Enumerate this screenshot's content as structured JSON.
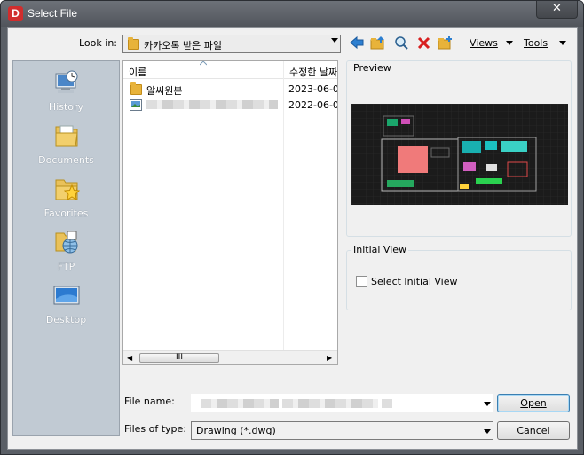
{
  "window": {
    "title": "Select File",
    "app_icon_letter": "D",
    "close_glyph": "✕"
  },
  "toolbar": {
    "look_in_label": "Look in:",
    "look_in_value": "카카오톡 받은 파일",
    "views_label": "Views",
    "tools_label": "Tools"
  },
  "places": [
    {
      "label": "History",
      "icon": "history-icon"
    },
    {
      "label": "Documents",
      "icon": "documents-icon"
    },
    {
      "label": "Favorites",
      "icon": "favorites-icon"
    },
    {
      "label": "FTP",
      "icon": "ftp-icon"
    },
    {
      "label": "Desktop",
      "icon": "desktop-icon"
    }
  ],
  "filelist": {
    "columns": [
      "이름",
      "수정한 날짜"
    ],
    "rows": [
      {
        "name": "알씨원본",
        "date": "2023-06-0",
        "type": "folder"
      },
      {
        "name": "",
        "date": "2022-06-0",
        "type": "image"
      }
    ],
    "scroll_grip": "III"
  },
  "preview": {
    "label": "Preview"
  },
  "initial_view": {
    "label": "Initial View",
    "checkbox_label": "Select Initial View",
    "checked": false
  },
  "bottom": {
    "file_name_label": "File name:",
    "file_name_value": "",
    "files_of_type_label": "Files of type:",
    "files_of_type_value": "Drawing (*.dwg)",
    "open_label": "Open",
    "cancel_label": "Cancel"
  },
  "colors": {
    "accent": "#3c7fb1",
    "title_bar": "#5a5f66",
    "places_bg": "#c1cad3",
    "folder": "#e8b33a"
  }
}
